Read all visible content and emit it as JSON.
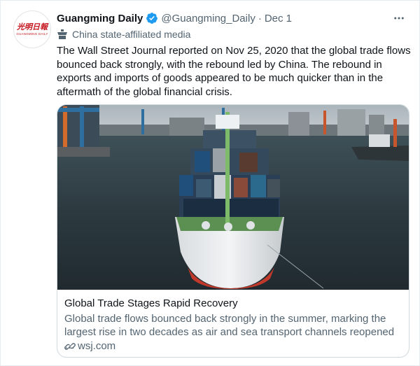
{
  "tweet": {
    "display_name": "Guangming Daily",
    "handle": "@Guangming_Daily",
    "separator": "·",
    "date": "Dec 1",
    "affiliation": "China state-affiliated media",
    "text": "The Wall Street Journal reported on Nov 25, 2020 that the global trade flows bounced back strongly, with the rebound led by China. The rebound in exports and imports of goods appeared to be much quicker than in the aftermath of the global financial crisis.",
    "avatar": {
      "logo_cn": "光明日報",
      "logo_en": "GUANGMING DAILY"
    },
    "verified_icon": "verified-badge-icon",
    "more_icon": "more-options-icon"
  },
  "card": {
    "title": "Global Trade Stages Rapid Recovery",
    "description": "Global trade flows bounced back strongly in the summer, marking the largest rise in two decades as air and sea transport channels reopened …",
    "domain": "wsj.com",
    "link_icon": "link-icon",
    "image": "cargo-ship-in-harbor"
  },
  "colors": {
    "verified": "#1d9bf0",
    "secondary_text": "#536471",
    "border": "#cfd9de",
    "logo_red": "#c4141b"
  }
}
